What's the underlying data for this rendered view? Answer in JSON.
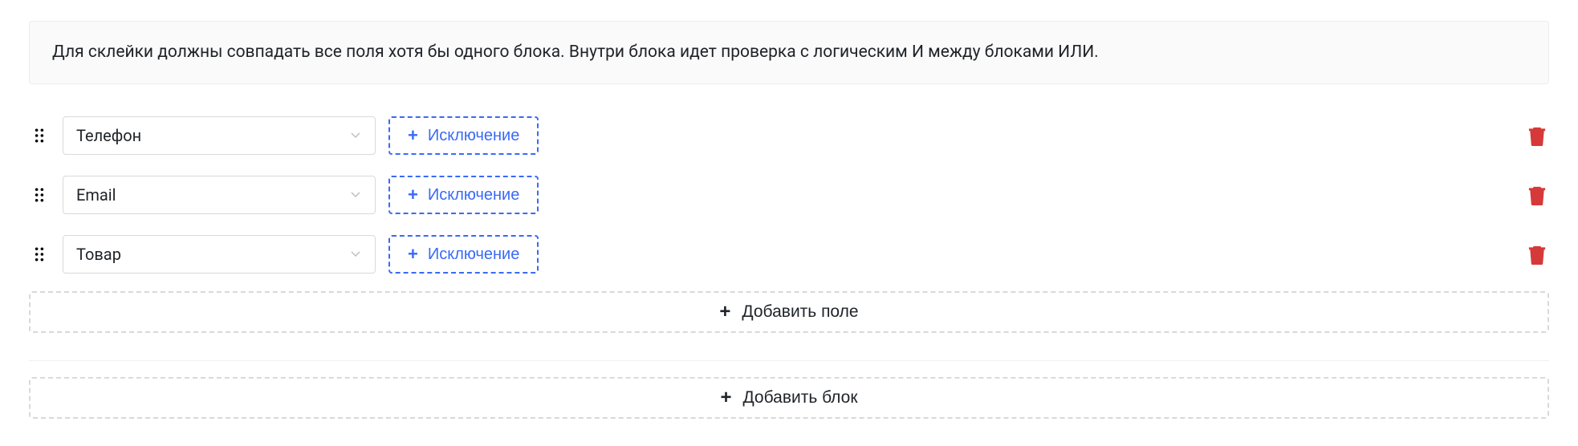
{
  "info_text": "Для склейки должны совпадать все поля хотя бы одного блока. Внутри блока идет проверка с логическим И между блоками ИЛИ.",
  "block": {
    "rows": [
      {
        "field": "Телефон",
        "exclude_label": "Исключение"
      },
      {
        "field": "Email",
        "exclude_label": "Исключение"
      },
      {
        "field": "Товар",
        "exclude_label": "Исключение"
      }
    ],
    "add_field_label": "Добавить поле"
  },
  "add_block_label": "Добавить блок"
}
